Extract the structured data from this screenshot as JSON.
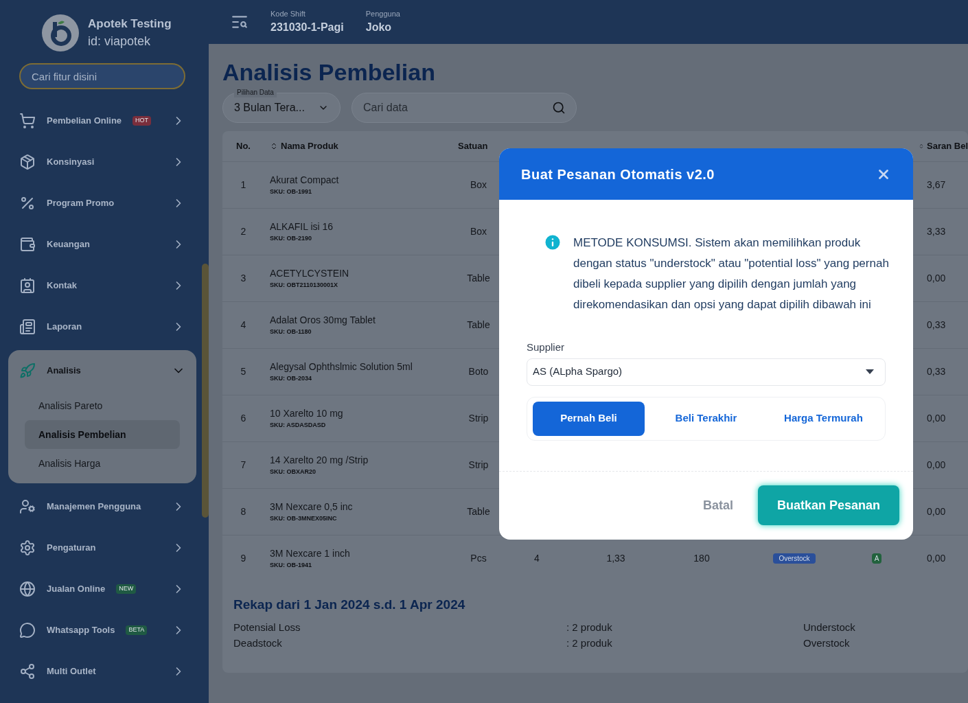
{
  "sidebar": {
    "brand": "Apotek Testing",
    "account": "id: viapotek",
    "search": {
      "placeholder": "Cari fitur disini"
    },
    "items": [
      {
        "label": "Pembelian Online",
        "badge": {
          "text": "HOT",
          "color": "#7a2e3c"
        },
        "expanded": false,
        "selected": false
      },
      {
        "label": "Konsinyasi",
        "expanded": false,
        "selected": false
      },
      {
        "label": "Program Promo",
        "expanded": false,
        "selected": false
      },
      {
        "label": "Keuangan",
        "expanded": false,
        "selected": false
      },
      {
        "label": "Kontak",
        "expanded": false,
        "selected": false
      },
      {
        "label": "Laporan",
        "expanded": false,
        "selected": false
      },
      {
        "label": "Analisis",
        "expanded": true,
        "selected": true,
        "children": [
          {
            "label": "Analisis Pareto",
            "selected": false
          },
          {
            "label": "Analisis Pembelian",
            "selected": true
          },
          {
            "label": "Analisis Harga",
            "selected": false
          }
        ]
      },
      {
        "label": "Manajemen Pengguna",
        "expanded": false,
        "selected": false
      },
      {
        "label": "Pengaturan",
        "expanded": false,
        "selected": false
      },
      {
        "label": "Jualan Online",
        "badge": {
          "text": "NEW",
          "color": "#1f5a43"
        },
        "expanded": false,
        "selected": false
      },
      {
        "label": "Whatsapp Tools",
        "badge": {
          "text": "BETA",
          "color": "#1f5a43"
        },
        "expanded": false,
        "selected": false
      },
      {
        "label": "Multi Outlet",
        "expanded": false,
        "selected": false
      }
    ]
  },
  "header": {
    "fields": [
      {
        "label": "Kode Shift",
        "value": "231030-1-Pagi"
      },
      {
        "label": "Pengguna",
        "value": "Joko"
      }
    ]
  },
  "page": {
    "title": "Analisis Pembelian",
    "data_select": {
      "label": "Pilihan Data",
      "value": "3 Bulan Tera..."
    },
    "search": {
      "placeholder": "Cari data"
    }
  },
  "table": {
    "columns": [
      {
        "label": "No.",
        "sortable": false
      },
      {
        "label": "Nama Produk",
        "sortable": true
      },
      {
        "label": "Satuan",
        "sortable": false
      },
      {
        "label": "Saran Bel",
        "sortable": true
      }
    ],
    "rows": [
      {
        "no": "1",
        "name": "Akurat Compact",
        "sku": "SKU: OB-1991",
        "unit": "Box",
        "suggested": "3,67"
      },
      {
        "no": "2",
        "name": "ALKAFIL isi 16",
        "sku": "SKU: OB-2190",
        "unit": "Box",
        "suggested": "3,33"
      },
      {
        "no": "3",
        "name": "ACETYLCYSTEIN",
        "sku": "SKU: OBT2110130001X",
        "unit": "Table",
        "suggested": "0,00"
      },
      {
        "no": "4",
        "name": "Adalat Oros 30mg Tablet",
        "sku": "SKU: OB-1180",
        "unit": "Table",
        "suggested": "0,33"
      },
      {
        "no": "5",
        "name": "Alegysal Ophthslmic Solution 5ml",
        "sku": "SKU: OB-2034",
        "unit": "Boto",
        "suggested": "0,33"
      },
      {
        "no": "6",
        "name": "10 Xarelto 10 mg",
        "sku": "SKU: ASDASDASD",
        "unit": "Strip",
        "suggested": "0,00"
      },
      {
        "no": "7",
        "name": "14 Xarelto 20 mg /Strip",
        "sku": "SKU: OBXAR20",
        "unit": "Strip",
        "suggested": "0,00"
      },
      {
        "no": "8",
        "name": "3M Nexcare 0,5 inc",
        "sku": "SKU: OB-3MNEX05INC",
        "unit": "Table",
        "suggested": "0,00"
      },
      {
        "no": "9",
        "name": "3M Nexcare 1 inch",
        "sku": "SKU: OB-1941",
        "unit": "Pcs",
        "sold": "4",
        "monthly_need": "1,33",
        "stock": "180",
        "status": "Overstock",
        "pareto": "A",
        "suggested": "0,00"
      }
    ]
  },
  "summary": {
    "title": "Rekap dari 1 Jan 2024 s.d. 1 Apr 2024",
    "left": [
      {
        "label": "Potensial Loss",
        "value": ": 2 produk"
      },
      {
        "label": "Deadstock",
        "value": ": 2 produk"
      }
    ],
    "right": [
      "Understock",
      "Overstock"
    ]
  },
  "modal": {
    "title": "Buat Pesanan Otomatis v2.0",
    "info": "METODE KONSUMSI. Sistem akan memilihkan produk dengan status \"understock\" atau \"potential loss\" yang pernah dibeli kepada supplier yang dipilih dengan jumlah yang direkomendasikan dan opsi yang dapat dipilih dibawah ini",
    "supplier": {
      "label": "Supplier",
      "value": "AS (ALpha Spargo)"
    },
    "options": [
      {
        "label": "Pernah Beli",
        "selected": true
      },
      {
        "label": "Beli Terakhir",
        "selected": false
      },
      {
        "label": "Harga Termurah",
        "selected": false
      }
    ],
    "cancel": "Batal",
    "submit": "Buatkan Pesanan"
  }
}
